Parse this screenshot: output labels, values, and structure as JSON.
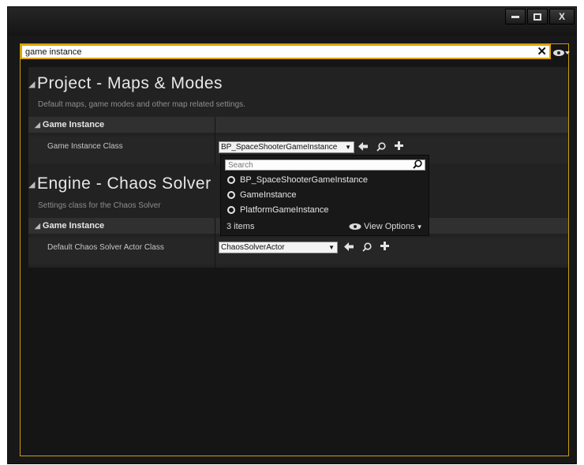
{
  "window": {
    "minimize_label": "−",
    "maximize_label": "□",
    "close_label": "X"
  },
  "search": {
    "value": "game instance",
    "clear_label": "✕"
  },
  "sections": [
    {
      "title": "Project - Maps & Modes",
      "description": "Default maps, game modes and other map related settings.",
      "category": "Game Instance",
      "property_label": "Game Instance Class",
      "property_value": "BP_SpaceShooterGameInstance"
    },
    {
      "title": "Engine - Chaos Solver",
      "description": "Settings class for the Chaos Solver",
      "category": "Game Instance",
      "property_label": "Default Chaos Solver Actor Class",
      "property_value": "ChaosSolverActor"
    }
  ],
  "picker": {
    "search_placeholder": "Search",
    "items": [
      "BP_SpaceShooterGameInstance",
      "GameInstance",
      "PlatformGameInstance"
    ],
    "count_label": "3 items",
    "view_options_label": "View Options"
  },
  "colors": {
    "accent": "#e0a600",
    "panel_border": "#c79d0f",
    "background": "#181818"
  },
  "icons": {
    "expand": "triangle-down",
    "use_selected": "arrow-left-icon",
    "browse": "magnifier-icon",
    "add": "plus-icon",
    "visibility": "eye-icon"
  }
}
